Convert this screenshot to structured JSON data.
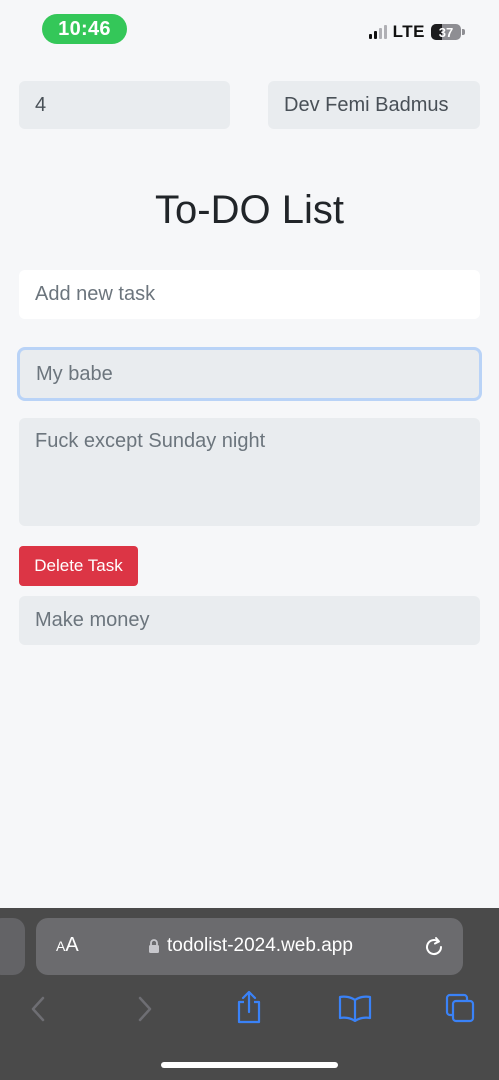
{
  "status_bar": {
    "time": "10:46",
    "network": "LTE",
    "battery": "37",
    "battery_level": 0.37,
    "signal_bars": 2
  },
  "header_fields": {
    "count_value": "4",
    "author_value": "Dev Femi Badmus"
  },
  "page": {
    "title": "To-DO List"
  },
  "new_task": {
    "placeholder": "Add new task"
  },
  "task": {
    "title_value": "My babe",
    "description_value": "Fuck except Sunday night",
    "delete_label": "Delete Task"
  },
  "task_list": {
    "item": "Make money"
  },
  "browser": {
    "text_size_label_small": "A",
    "text_size_label_large": "A",
    "url": "todolist-2024.web.app"
  },
  "colors": {
    "status_pill": "#34c759",
    "delete": "#dc3545",
    "focus_border": "#b9d3f7",
    "toolbar": "#4a4a4a",
    "nav_active": "#3a82f7"
  },
  "icons": [
    "lock-icon",
    "reload-icon",
    "back-icon",
    "forward-icon",
    "share-icon",
    "bookmarks-icon",
    "tabs-icon"
  ]
}
